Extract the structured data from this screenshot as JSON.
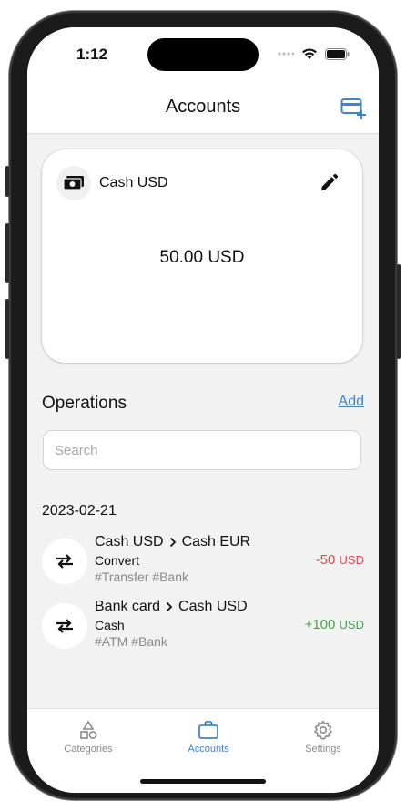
{
  "status_bar": {
    "time": "1:12"
  },
  "header": {
    "title": "Accounts"
  },
  "account_card": {
    "name": "Cash USD",
    "balance": "50.00 USD"
  },
  "operations": {
    "title": "Operations",
    "add_label": "Add",
    "search_placeholder": "Search",
    "date": "2023-02-21",
    "items": [
      {
        "from": "Cash USD",
        "to": "Cash EUR",
        "type": "Convert",
        "tags": "#Transfer #Bank",
        "amount": "-50",
        "currency": "USD"
      },
      {
        "from": "Bank card",
        "to": "Cash USD",
        "type": "Cash",
        "tags": "#ATM #Bank",
        "amount": "+100",
        "currency": "USD"
      }
    ]
  },
  "tabbar": {
    "tabs": [
      {
        "label": "Categories",
        "icon": "shapes-icon"
      },
      {
        "label": "Accounts",
        "icon": "briefcase-icon",
        "active": true
      },
      {
        "label": "Settings",
        "icon": "gear-icon"
      }
    ]
  },
  "colors": {
    "accent": "#3b86d1",
    "negative": "#d34d52",
    "positive": "#46a34f"
  }
}
